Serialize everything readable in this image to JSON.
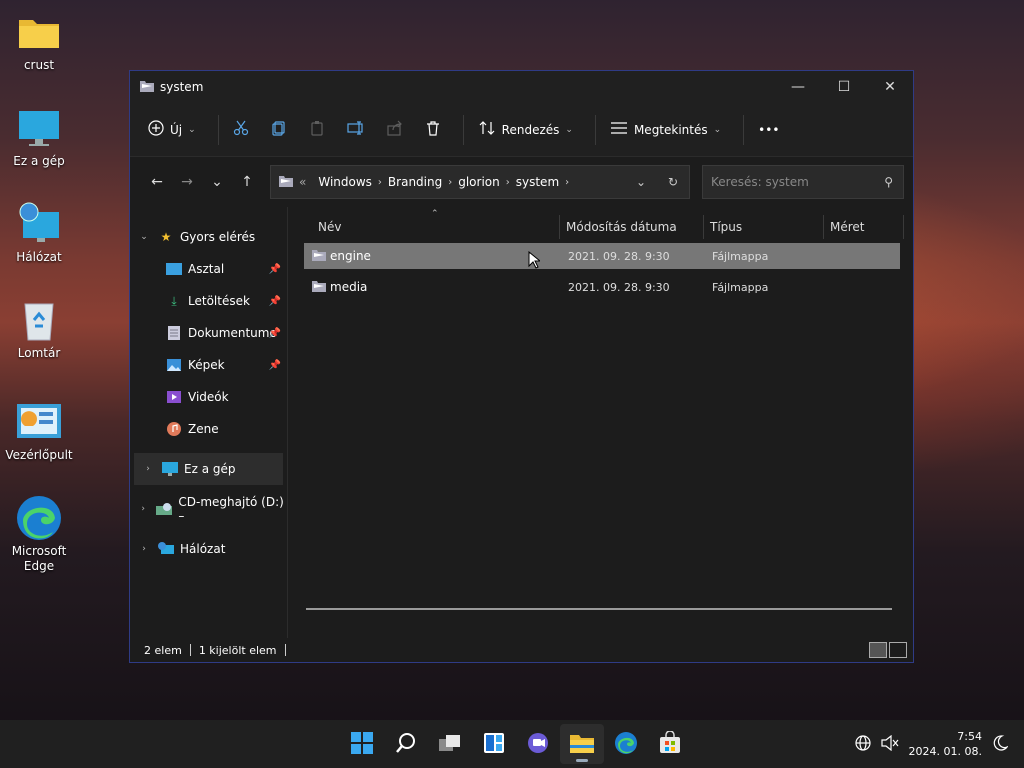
{
  "desktop": {
    "icons": [
      {
        "label": "crust"
      },
      {
        "label": "Ez a gép"
      },
      {
        "label": "Hálózat"
      },
      {
        "label": "Lomtár"
      },
      {
        "label": "Vezérlőpult"
      },
      {
        "label": "Microsoft Edge"
      }
    ]
  },
  "window": {
    "title": "system",
    "controls": {
      "minimize": "—",
      "maximize": "☐",
      "close": "✕"
    }
  },
  "toolbar": {
    "new_label": "Új",
    "sort_label": "Rendezés",
    "view_label": "Megtekintés",
    "more_label": "•••"
  },
  "address": {
    "prefix": "«",
    "crumbs": [
      "Windows",
      "Branding",
      "glorion",
      "system"
    ]
  },
  "search": {
    "placeholder": "Keresés: system"
  },
  "sidebar": {
    "quick_access": "Gyors elérés",
    "items": [
      {
        "label": "Asztal"
      },
      {
        "label": "Letöltések"
      },
      {
        "label": "Dokumentumo"
      },
      {
        "label": "Képek"
      },
      {
        "label": "Videók"
      },
      {
        "label": "Zene"
      }
    ],
    "this_pc": "Ez a gép",
    "cd_drive": "CD-meghajtó (D:) –",
    "network": "Hálózat"
  },
  "columns": {
    "name": "Név",
    "modified": "Módosítás dátuma",
    "type": "Típus",
    "size": "Méret"
  },
  "files": [
    {
      "name": "engine",
      "modified": "2021. 09. 28. 9:30",
      "type": "Fájlmappa",
      "size": ""
    },
    {
      "name": "media",
      "modified": "2021. 09. 28. 9:30",
      "type": "Fájlmappa",
      "size": ""
    }
  ],
  "status": {
    "count": "2 elem",
    "selected": "1 kijelölt elem"
  },
  "taskbar": {
    "time": "7:54",
    "date": "2024. 01. 08."
  },
  "colors": {
    "accent": "#2f3b86",
    "selection": "#777777"
  }
}
